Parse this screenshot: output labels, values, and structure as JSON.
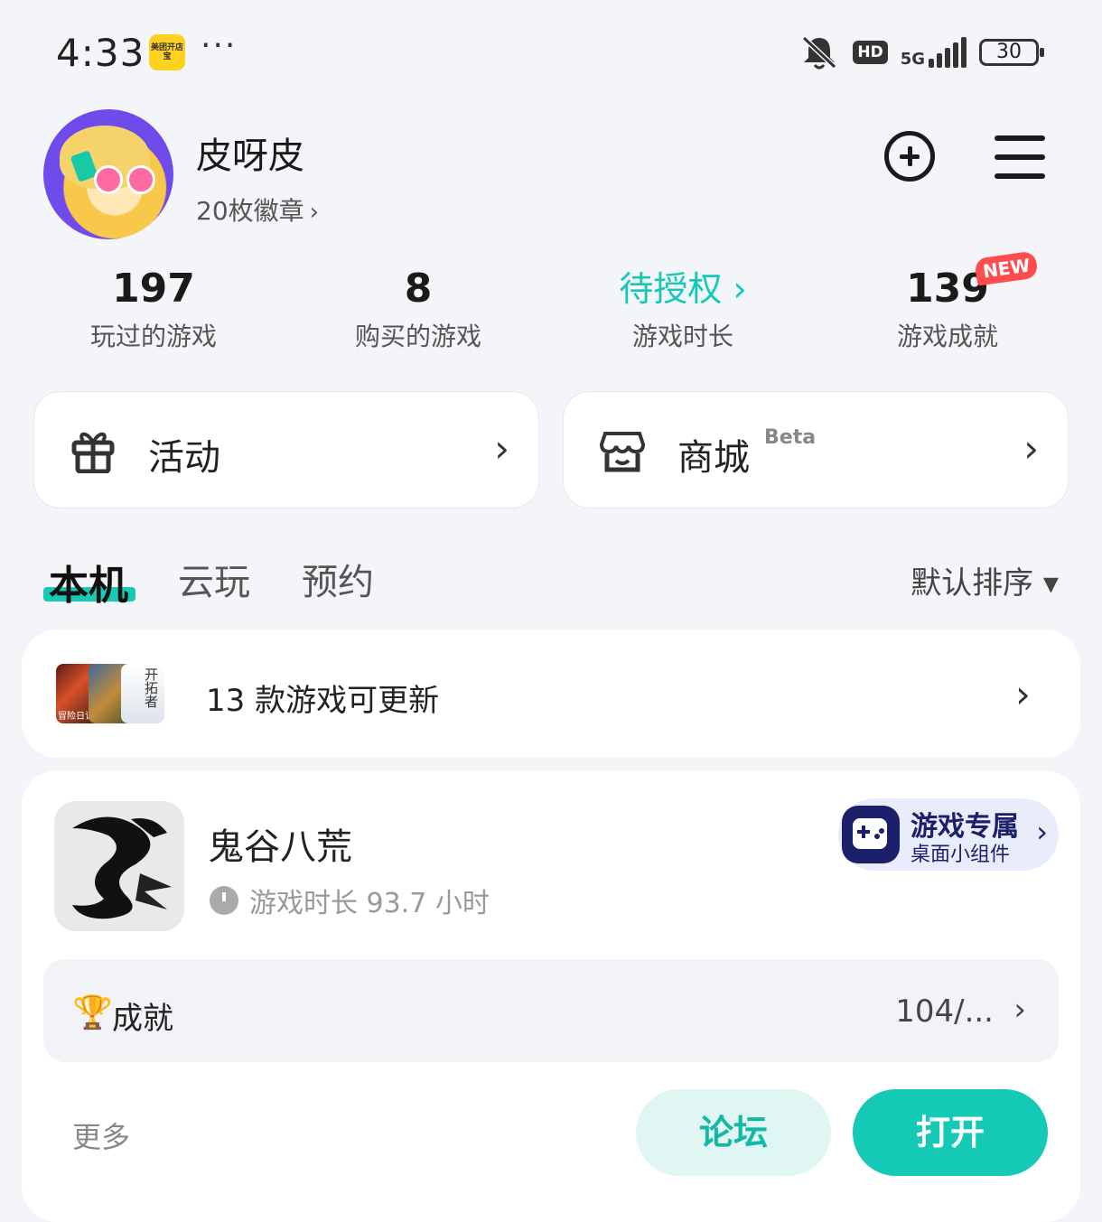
{
  "status_bar": {
    "time": "4:33",
    "app_badge": "美团开店宝",
    "dots": "···",
    "hd": "HD",
    "network": "5G",
    "battery": "30"
  },
  "profile": {
    "name": "皮呀皮",
    "badges": "20枚徽章",
    "chevron": "›"
  },
  "stats": [
    {
      "value": "197",
      "label": "玩过的游戏"
    },
    {
      "value": "8",
      "label": "购买的游戏"
    },
    {
      "value": "待授权 ›",
      "label": "游戏时长"
    },
    {
      "value": "139",
      "label": "游戏成就",
      "tag": "NEW"
    }
  ],
  "cards": {
    "activity": {
      "label": "活动",
      "chevron": "›"
    },
    "store": {
      "label": "商城",
      "badge": "Beta",
      "chevron": "›"
    }
  },
  "tabs": {
    "items": [
      "本机",
      "云玩",
      "预约"
    ],
    "active": 0,
    "sort": "默认排序 ▾"
  },
  "updates": {
    "text": "13 款游戏可更新",
    "chevron": "›",
    "thumb_label": "冒险日记",
    "thumb_calligraphy": "开拓者"
  },
  "game": {
    "name": "鬼谷八荒",
    "playtime": "游戏时长 93.7 小时",
    "widget": {
      "title": "游戏专属",
      "subtitle": "桌面小组件",
      "chevron": "›"
    },
    "achievement": {
      "icon": "trophy-icon",
      "label": "成就",
      "value": "104/...",
      "chevron": "›"
    },
    "more": "更多",
    "forum_button": "论坛",
    "open_button": "打开"
  },
  "colors": {
    "accent": "#14c9b5",
    "badge_red": "#ff4d4f",
    "widget_navy": "#1c1f6a"
  }
}
